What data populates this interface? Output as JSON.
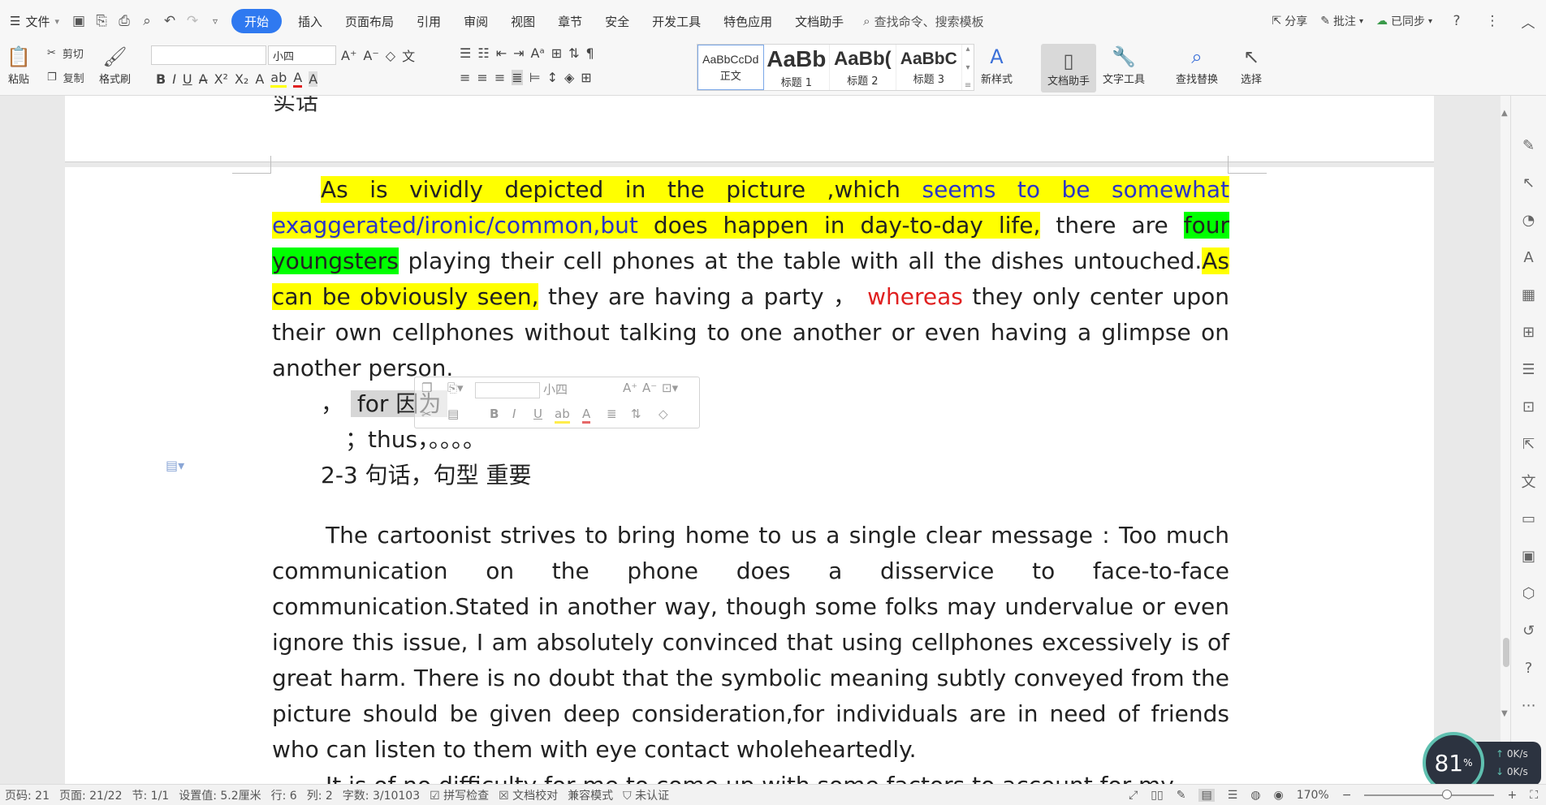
{
  "menubar": {
    "file_label": "文件",
    "tabs": [
      "开始",
      "插入",
      "页面布局",
      "引用",
      "审阅",
      "视图",
      "章节",
      "安全",
      "开发工具",
      "特色应用",
      "文档助手"
    ],
    "search_placeholder": "查找命令、搜索模板",
    "right": {
      "share": "分享",
      "comment": "批注",
      "sync": "已同步"
    }
  },
  "ribbon": {
    "paste": "粘贴",
    "cut": "剪切",
    "copy": "复制",
    "format_painter": "格式刷",
    "font_size": "小四",
    "styles": [
      {
        "sample": "AaBbCcDd",
        "name": "正文"
      },
      {
        "sample": "AaBb",
        "name": "标题 1"
      },
      {
        "sample": "AaBb(",
        "name": "标题 2"
      },
      {
        "sample": "AaBbC",
        "name": "标题 3"
      }
    ],
    "new_style": "新样式",
    "doc_assistant": "文档助手",
    "text_tools": "文字工具",
    "find_replace": "查找替换",
    "select": "选择"
  },
  "document": {
    "prev_page_tail": "实话",
    "para1": {
      "s1": "As is vividly depicted in the picture ,which ",
      "s2": "seems to be somewhat exaggerated/ironic/common,but",
      "s3": " does happen in day-to-day life,",
      "s4": " there are ",
      "s5": "four youngsters",
      "s6": " playing their cell phones at the table with all the dishes untouched.",
      "s7": "As can be obviously seen,",
      "s8": " they are having a party ，  ",
      "s9": "whereas",
      "s10": " they only center upon their own cellphones without talking to one another or even having a glimpse on another person."
    },
    "note1_prefix": "，",
    "note1_text": "for 因为",
    "note2": "；thus，。。。。",
    "heading": "2-3 句话，句型  重要",
    "para2": "The cartoonist strives to bring home to us a single clear message : Too much communication on the phone does a disservice to face-to-face communication.Stated in another way, though some folks may undervalue or even ignore this issue, I am absolutely convinced that using cellphones excessively is of great harm. There is no doubt that the symbolic meaning subtly conveyed from the picture should be given deep consideration,for individuals are in need of friends who can listen to them with eye contact wholeheartedly.",
    "para3": "It is of no difficulty for me to come up with some factors to account for my"
  },
  "mini_toolbar": {
    "font_size": "小四"
  },
  "statusbar": {
    "page_num": "页码: 21",
    "pages": "页面: 21/22",
    "section": "节: 1/1",
    "setting": "设置值: 5.2厘米",
    "row": "行: 6",
    "col": "列: 2",
    "word_count": "字数: 3/10103",
    "spell_check": "拼写检查",
    "doc_proof": "文档校对",
    "compat": "兼容模式",
    "cert": "未认证",
    "zoom": "170%"
  },
  "speed_widget": {
    "percent": "81",
    "unit": "%",
    "up": "0K/s",
    "down": "0K/s"
  },
  "colors": {
    "accent": "#2f79f0",
    "highlight_yellow": "#ffff00",
    "highlight_green": "#00ff00",
    "blue_text": "#2a35c9",
    "red_text": "#e02020"
  }
}
